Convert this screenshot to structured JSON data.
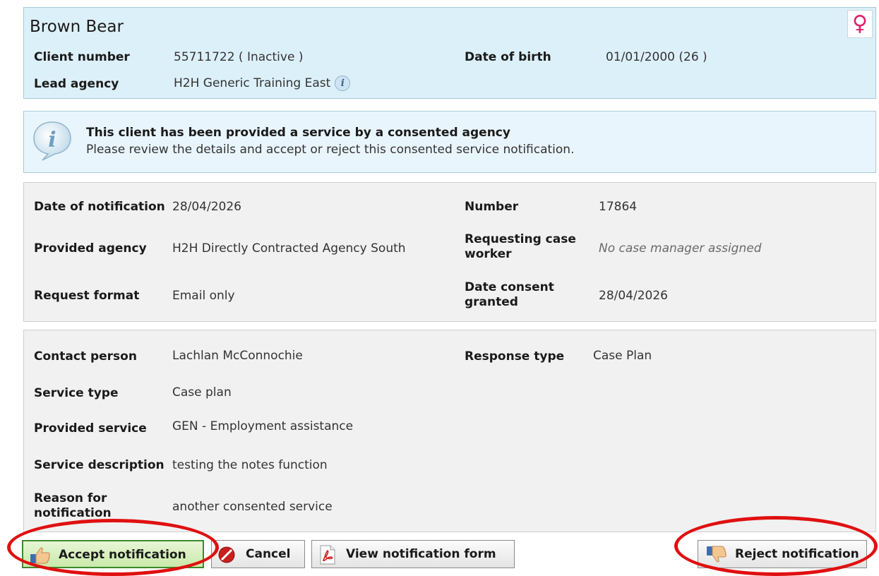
{
  "client": {
    "name": "Brown Bear",
    "client_number_label": "Client number",
    "client_number_value": "55711722 ( Inactive )",
    "dob_label": "Date of birth",
    "dob_value": "01/01/2000 (26 )",
    "lead_agency_label": "Lead agency",
    "lead_agency_value": "H2H Generic Training East",
    "gender_symbol": "♀"
  },
  "banner": {
    "title": "This client has been provided a service by a consented agency",
    "text": "Please review the details and accept or reject this consented service notification."
  },
  "notification": {
    "date_label": "Date of notification",
    "date_value": "28/04/2026",
    "number_label": "Number",
    "number_value": "17864",
    "provided_agency_label": "Provided agency",
    "provided_agency_value": "H2H Directly Contracted Agency South",
    "requesting_worker_label_1": "Requesting case",
    "requesting_worker_label_2": "worker",
    "requesting_worker_value": "No case manager assigned",
    "request_format_label": "Request format",
    "request_format_value": "Email only",
    "consent_label_1": "Date consent",
    "consent_label_2": "granted",
    "consent_value": "28/04/2026"
  },
  "service": {
    "contact_label": "Contact person",
    "contact_value": "Lachlan McConnochie",
    "response_type_label": "Response type",
    "response_type_value": "Case Plan",
    "service_type_label": "Service type",
    "service_type_value": "Case plan",
    "provided_service_label": "Provided service",
    "provided_service_value": "GEN - Employment assistance",
    "description_label": "Service description",
    "description_value": "testing the notes function",
    "reason_label_1": "Reason for",
    "reason_label_2": "notification",
    "reason_value": "another consented service"
  },
  "buttons": {
    "accept": "Accept notification",
    "cancel": "Cancel",
    "view": "View notification form",
    "reject": "Reject notification"
  },
  "colors": {
    "header_bg": "#dcf0fa",
    "panel_bg": "#f1f1f1",
    "highlight_red": "#e01010",
    "accept_green": "#3d8a2a"
  }
}
